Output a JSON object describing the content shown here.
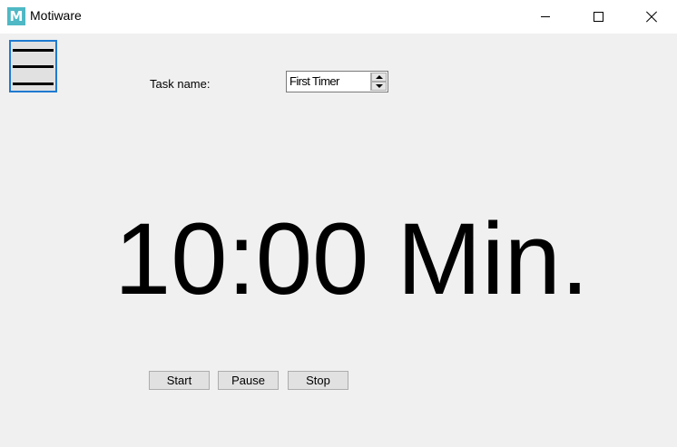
{
  "window": {
    "title": "Motiware",
    "icon_letter": "M",
    "accent": "#4fb8c4"
  },
  "menu": {
    "icon": "hamburger-menu-icon",
    "border_color": "#1f7ad1"
  },
  "task": {
    "label": "Task name:",
    "value": "First Timer"
  },
  "timer": {
    "display": "10:00 Min."
  },
  "controls": {
    "start": "Start",
    "pause": "Pause",
    "stop": "Stop"
  }
}
